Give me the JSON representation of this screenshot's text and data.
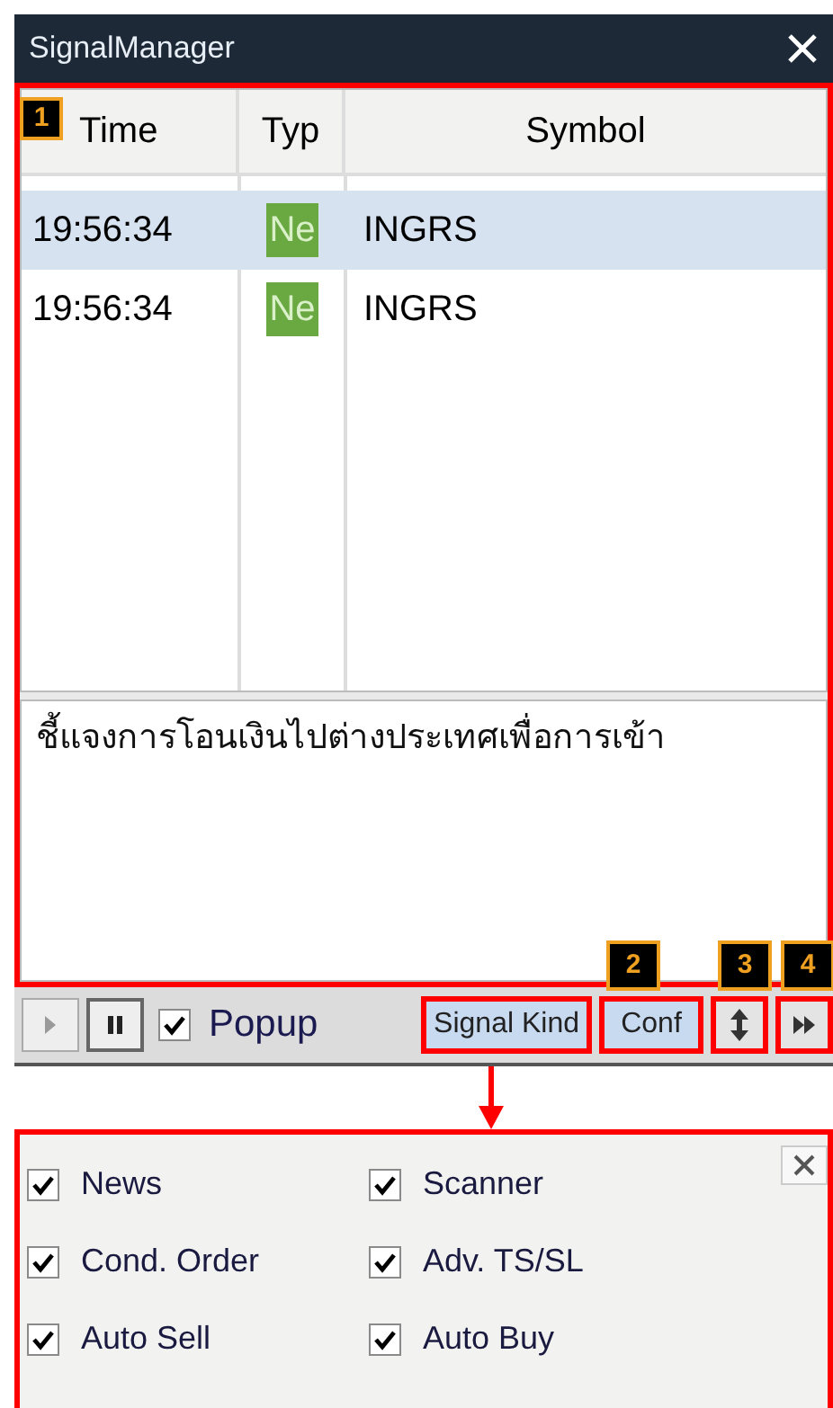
{
  "window": {
    "title": "SignalManager"
  },
  "table": {
    "columns": [
      "Time",
      "Typ",
      "Symbol"
    ],
    "rows": [
      {
        "time": "19:56:34",
        "type": "Ne",
        "symbol": "INGRS",
        "selected": true
      },
      {
        "time": "19:56:34",
        "type": "Ne",
        "symbol": "INGRS",
        "selected": false
      }
    ]
  },
  "detail": {
    "text": "ชี้แจงการโอนเงินไปต่างประเทศเพื่อการเข้า"
  },
  "callouts": [
    "1",
    "2",
    "3",
    "4"
  ],
  "toolbar": {
    "popup": {
      "label": "Popup",
      "checked": true
    },
    "signal_kind": "Signal Kind",
    "conf": "Conf"
  },
  "signal_kind_panel": {
    "items": [
      {
        "label": "News",
        "checked": true
      },
      {
        "label": "Scanner",
        "checked": true
      },
      {
        "label": "Cond. Order",
        "checked": true
      },
      {
        "label": "Adv. TS/SL",
        "checked": true
      },
      {
        "label": "Auto Sell",
        "checked": true
      },
      {
        "label": "Auto Buy",
        "checked": true
      }
    ]
  }
}
